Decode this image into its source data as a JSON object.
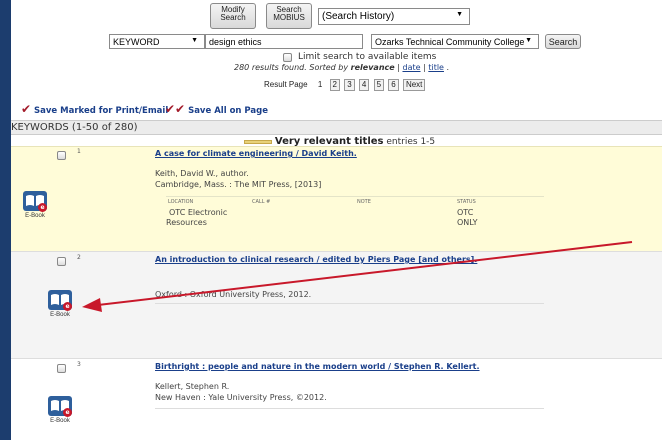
{
  "search": {
    "modify_label": "Modify Search",
    "mobius_label": "Search MOBIUS",
    "history_value": "(Search History)",
    "field_value": "KEYWORD",
    "query_value": "design ethics",
    "library_value": "Ozarks Technical Community College",
    "submit_label": "Search",
    "limit_label": "Limit search to available items"
  },
  "results_info": {
    "found_text": "280 results found.",
    "sorted_by": "Sorted by",
    "sort_relevance": "relevance",
    "sort_date": "date",
    "sort_title": "title",
    "result_page_label": "Result Page",
    "pages": [
      "1",
      "2",
      "3",
      "4",
      "5",
      "6"
    ],
    "next_label": "Next"
  },
  "actions": {
    "save_marked": "Save Marked for Print/Email",
    "save_all": "Save All on Page"
  },
  "keywords_header": "KEYWORDS (1-50 of 280)",
  "relevance_band": {
    "title": "Very relevant titles",
    "range": "entries 1-5"
  },
  "holdings_headers": {
    "location": "LOCATION",
    "call": "CALL #",
    "note": "NOTE",
    "status": "STATUS"
  },
  "results": [
    {
      "number": "1",
      "title": "A case for climate engineering / David Keith.",
      "line1": "Keith, David W., author.",
      "line2": "Cambridge, Mass. : The MIT Press, [2013]",
      "location_1": "OTC Electronic",
      "location_2": "Resources",
      "status_1": "OTC",
      "status_2": "ONLY",
      "format": "E-Book"
    },
    {
      "number": "2",
      "title": "An introduction to clinical research / edited by Piers Page [and others].",
      "line1": "Oxford : Oxford University Press, 2012.",
      "format": "E-Book"
    },
    {
      "number": "3",
      "title": "Birthright : people and nature in the modern world / Stephen R. Kellert.",
      "line1": "Kellert, Stephen R.",
      "line2": "New Haven : Yale University Press, ©2012.",
      "format": "E-Book"
    }
  ],
  "colors": {
    "frame": "#1c3d6e",
    "highlight_row": "#fffcd8",
    "alt_row": "#f4f4f4",
    "link": "#1a3f8a",
    "annotation_arrow": "#c8182a",
    "checkmark": "#a31b2a"
  }
}
